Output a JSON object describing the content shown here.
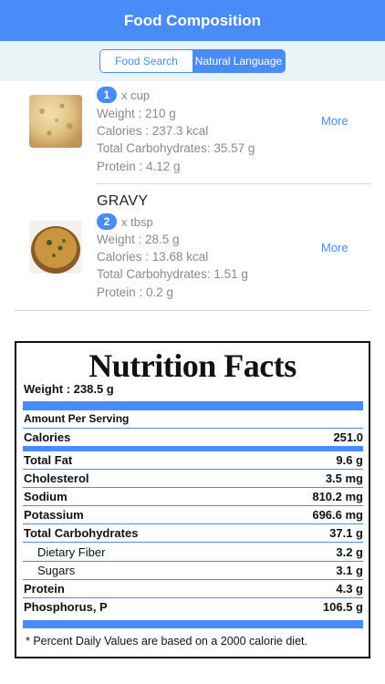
{
  "header": {
    "title": "Food Composition"
  },
  "segments": {
    "food_search": "Food Search",
    "natural_language": "Natural Language"
  },
  "items": [
    {
      "name": "",
      "qty": "1",
      "unit": "x cup",
      "weight": "Weight : 210 g",
      "calories": "Calories : 237.3 kcal",
      "carbs": "Total Carbohydrates: 35.57 g",
      "protein": "Protein : 4.12 g",
      "more": "More"
    },
    {
      "name": "GRAVY",
      "qty": "2",
      "unit": "x tbsp",
      "weight": "Weight : 28.5 g",
      "calories": "Calories : 13.68 kcal",
      "carbs": "Total Carbohydrates: 1.51 g",
      "protein": "Protein : 0.2 g",
      "more": "More"
    }
  ],
  "nutrition": {
    "title": "Nutrition Facts",
    "weight": "Weight : 238.5 g",
    "amount_per_serving": "Amount Per Serving",
    "calories": {
      "label": "Calories",
      "value": "251.0"
    },
    "rows": [
      {
        "label": "Total Fat",
        "value": "9.6 g"
      },
      {
        "label": "Cholesterol",
        "value": "3.5 mg"
      },
      {
        "label": "Sodium",
        "value": "810.2 mg"
      },
      {
        "label": "Potassium",
        "value": "696.6 mg"
      },
      {
        "label": "Total Carbohydrates",
        "value": "37.1 g"
      },
      {
        "label": "Dietary Fiber",
        "value": "3.2 g"
      },
      {
        "label": "Sugars",
        "value": "3.1 g"
      },
      {
        "label": "Protein",
        "value": "4.3 g"
      },
      {
        "label": "Phosphorus, P",
        "value": "106.5 g"
      }
    ],
    "footnote": "* Percent Daily Values are based on a 2000 calorie diet."
  },
  "colors": {
    "accent": "#4a8cf7",
    "segment_bg": "#e9f4f7"
  },
  "icons": {
    "item0_image": "flatbread-photo",
    "item1_image": "gravy-bowl-photo"
  }
}
